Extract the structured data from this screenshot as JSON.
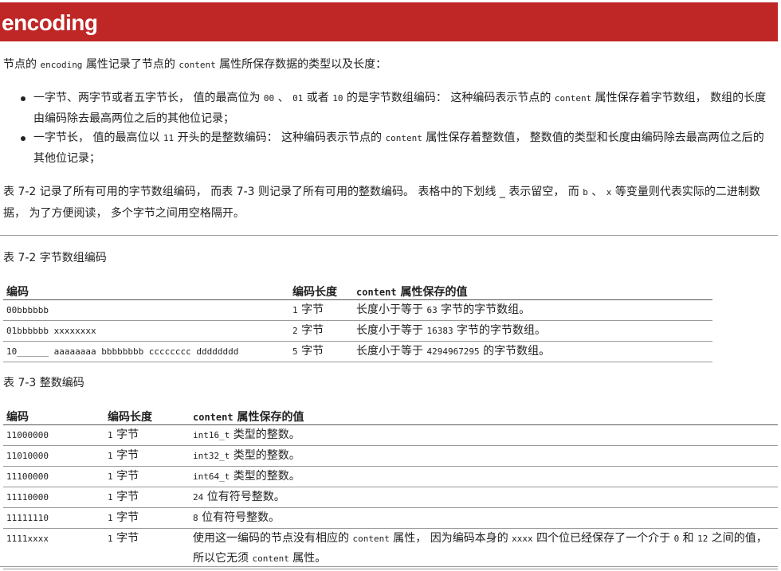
{
  "header": {
    "title": "encoding"
  },
  "intro": {
    "a": "节点的 ",
    "code1": "encoding",
    "b": " 属性记录了节点的 ",
    "code2": "content",
    "c": " 属性所保存数据的类型以及长度："
  },
  "bullets": [
    {
      "a": "一字节、两字节或者五字节长， 值的最高位为 ",
      "c1": "00",
      "b": " 、 ",
      "c2": "01",
      "c": " 或者 ",
      "c3": "10",
      "d": " 的是字节数组编码： 这种编码表示节点的 ",
      "c4": "content",
      "e": " 属性保存着字节数组， 数组的长度由编码除去最高两位之后的其他位记录；"
    },
    {
      "a": "一字节长， 值的最高位以 ",
      "c1": "11",
      "b": " 开头的是整数编码： 这种编码表示节点的 ",
      "c2": "content",
      "c": " 属性保存着整数值， 整数值的类型和长度由编码除去最高两位之后的其他位记录；"
    }
  ],
  "para2": {
    "a": "表 7-2 记录了所有可用的字节数组编码， 而表 7-3 则记录了所有可用的整数编码。 表格中的下划线 _ 表示留空， 而 ",
    "c1": "b",
    "b": " 、 ",
    "c2": "x",
    "c": " 等变量则代表实际的二进制数据， 为了方便阅读， 多个字节之间用空格隔开。"
  },
  "table2": {
    "caption": "表 7-2 字节数组编码",
    "headers": {
      "encoding": "编码",
      "length": "编码长度",
      "value_code": "content",
      "value_rest": " 属性保存的值"
    },
    "rows": [
      {
        "enc": "00bbbbbb",
        "len_num": "1",
        "len_unit": " 字节",
        "v_a": "长度小于等于 ",
        "v_num": "63",
        "v_b": " 字节的字节数组。"
      },
      {
        "enc": "01bbbbbb xxxxxxxx",
        "len_num": "2",
        "len_unit": " 字节",
        "v_a": "长度小于等于 ",
        "v_num": "16383",
        "v_b": " 字节的字节数组。"
      },
      {
        "enc": "10______ aaaaaaaa bbbbbbbb cccccccc dddddddd",
        "len_num": "5",
        "len_unit": " 字节",
        "v_a": "长度小于等于 ",
        "v_num": "4294967295",
        "v_b": " 的字节数组。"
      }
    ]
  },
  "table3": {
    "caption": "表 7-3 整数编码",
    "headers": {
      "encoding": "编码",
      "length": "编码长度",
      "value_code": "content",
      "value_rest": " 属性保存的值"
    },
    "rows": [
      {
        "enc": "11000000",
        "len_num": "1",
        "len_unit": " 字节",
        "v_code": "int16_t",
        "v_rest": " 类型的整数。"
      },
      {
        "enc": "11010000",
        "len_num": "1",
        "len_unit": " 字节",
        "v_code": "int32_t",
        "v_rest": " 类型的整数。"
      },
      {
        "enc": "11100000",
        "len_num": "1",
        "len_unit": " 字节",
        "v_code": "int64_t",
        "v_rest": " 类型的整数。"
      },
      {
        "enc": "11110000",
        "len_num": "1",
        "len_unit": " 字节",
        "v_code": "24",
        "v_rest": " 位有符号整数。"
      },
      {
        "enc": "11111110",
        "len_num": "1",
        "len_unit": " 字节",
        "v_code": "8",
        "v_rest": " 位有符号整数。"
      },
      {
        "enc": "1111xxxx",
        "len_num": "1",
        "len_unit": " 字节",
        "v_a": "使用这一编码的节点没有相应的 ",
        "v_c1": "content",
        "v_b": " 属性， 因为编码本身的 ",
        "v_c2": "xxxx",
        "v_c": " 四个位已经保存了一个介于 ",
        "v_c3": "0",
        "v_d": " 和 ",
        "v_c4": "12",
        "v_e": " 之间的值， 所以它无须 ",
        "v_c5": "content",
        "v_f": " 属性。"
      }
    ]
  }
}
